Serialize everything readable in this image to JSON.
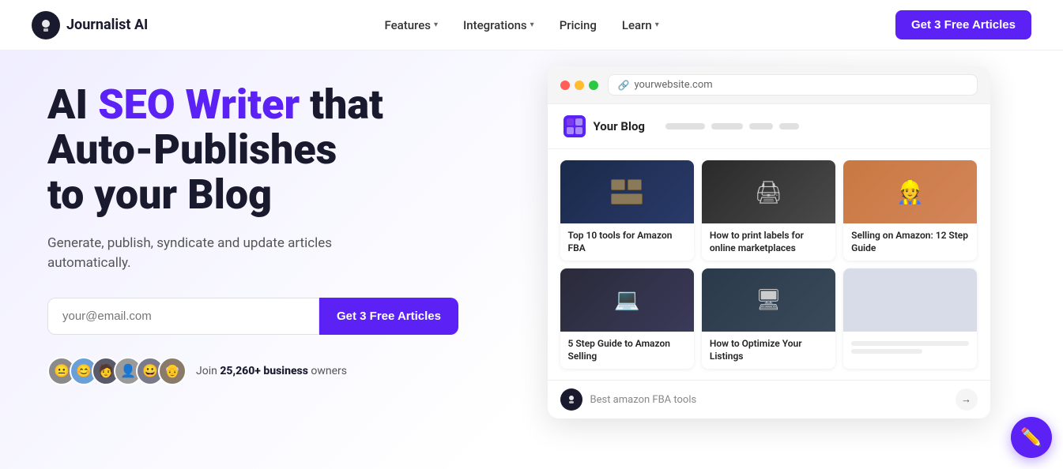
{
  "navbar": {
    "logo_text": "Journalist AI",
    "nav_items": [
      {
        "label": "Features",
        "has_dropdown": true
      },
      {
        "label": "Integrations",
        "has_dropdown": true
      },
      {
        "label": "Pricing",
        "has_dropdown": false
      },
      {
        "label": "Learn",
        "has_dropdown": true
      }
    ],
    "cta_label": "Get 3 Free Articles"
  },
  "hero": {
    "title_plain": "AI ",
    "title_highlight": "SEO Writer",
    "title_rest": " that Auto-Publishes to your Blog",
    "subtitle": "Generate, publish, syndicate and update articles automatically.",
    "email_placeholder": "your@email.com",
    "cta_label": "Get 3 Free Articles",
    "social_proof_text": "Join ",
    "social_proof_bold": "25,260+ business",
    "social_proof_end": " owners"
  },
  "browser": {
    "url": "yourwebsite.com",
    "blog_title": "Your Blog",
    "cards": [
      {
        "title": "Top 10 tools for Amazon FBA",
        "img_type": "boxes"
      },
      {
        "title": "How to print labels for online marketplaces",
        "img_type": "printer"
      },
      {
        "title": "Selling on Amazon: 12 Step Guide",
        "img_type": "person"
      },
      {
        "title": "5 Step Guide to Amazon Selling",
        "img_type": "laptop"
      },
      {
        "title": "How to Optimize Your Listings",
        "img_type": "screen"
      },
      {
        "title": "",
        "img_type": "placeholder"
      }
    ],
    "chat_placeholder": "Best amazon FBA tools",
    "chat_send_icon": "→"
  },
  "colors": {
    "accent": "#5b21f5",
    "dark": "#1a1a2e",
    "text_muted": "#555"
  }
}
